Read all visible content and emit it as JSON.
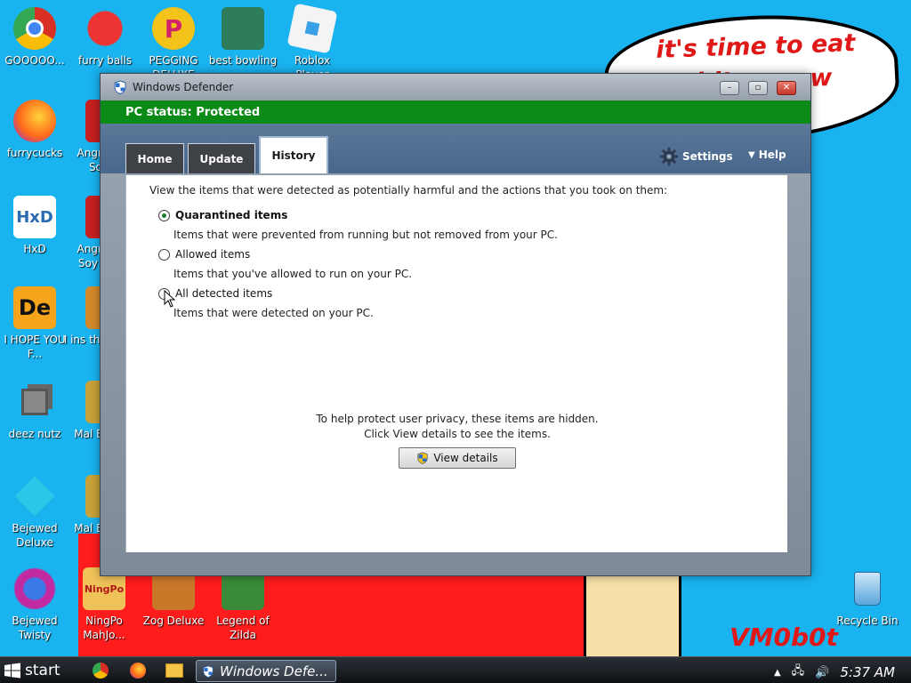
{
  "desktop": {
    "bubble_text": "it's time to eat shit ... new",
    "signature": "VM0b0t",
    "icons": [
      {
        "label": "GOOOOO...",
        "icon": "chrome-icon",
        "color": "#2a8a3a"
      },
      {
        "label": "furry balls",
        "icon": "red-creature-icon",
        "color": "#d12a2a"
      },
      {
        "label": "PEGGING DELUXE",
        "icon": "peggle-icon",
        "color": "#e34b9a"
      },
      {
        "label": "best bowling ...",
        "icon": "santa-icon",
        "color": "#3a8a5a"
      },
      {
        "label": "Roblox Player",
        "icon": "roblox-icon",
        "color": "#f2f2f2"
      },
      {
        "label": "furrycucks",
        "icon": "firefox-icon",
        "color": "#ff7a1a"
      },
      {
        "label": "Angry Soy",
        "icon": "angry-bird-icon",
        "color": "#c72020"
      },
      {
        "label": "HxD",
        "icon": "hxd-icon",
        "color": "#e9e9e9"
      },
      {
        "label": "Angry Soy V",
        "icon": "angry-bird-icon",
        "color": "#c72020"
      },
      {
        "label": "I HOPE YOU F...",
        "icon": "de-icon",
        "color": "#f2a11a"
      },
      {
        "label": "I ins this",
        "icon": "character-icon",
        "color": "#d48a2a"
      },
      {
        "label": "deez nutz",
        "icon": "window-stack-icon",
        "color": "#444444"
      },
      {
        "label": "Mal Es",
        "icon": "mahjong-icon",
        "color": "#c9a23a"
      },
      {
        "label": "Bejewed Deluxe",
        "icon": "gem-icon",
        "color": "#2cc7e8"
      },
      {
        "label": "Mal Es",
        "icon": "mahjong-icon",
        "color": "#c9a23a"
      },
      {
        "label": "Bejewed Twisty",
        "icon": "gem-icon",
        "color": "#c12aa0"
      },
      {
        "label": "NingPo MahJo...",
        "icon": "ningpo-icon",
        "color": "#d8a63a"
      },
      {
        "label": "Zog Deluxe",
        "icon": "zog-icon",
        "color": "#c9782a"
      },
      {
        "label": "Legend of Zilda",
        "icon": "link-icon",
        "color": "#3a8a3a"
      },
      {
        "label": "Recycle Bin",
        "icon": "recycle-bin-icon",
        "color": "#6ab0e0"
      }
    ]
  },
  "window": {
    "title": "Windows Defender",
    "status": "PC status: Protected",
    "tabs": [
      {
        "label": "Home"
      },
      {
        "label": "Update"
      },
      {
        "label": "History"
      }
    ],
    "settings_label": "Settings",
    "help_label": "Help",
    "intro": "View the items that were detected as potentially harmful and the actions that you took on them:",
    "options": [
      {
        "label": "Quarantined items",
        "desc": "Items that were prevented from running but not removed from your PC.",
        "selected": true
      },
      {
        "label": "Allowed items",
        "desc": "Items that you've allowed to run on your PC.",
        "selected": false
      },
      {
        "label": "All detected items",
        "desc": "Items that were detected on your PC.",
        "selected": false
      }
    ],
    "privacy_line1": "To help protect user privacy, these items are hidden.",
    "privacy_line2": "Click View details to see the items.",
    "view_details_label": "View details"
  },
  "taskbar": {
    "start_label": "start",
    "active_task": "Windows Defe...",
    "clock": "5:37 AM"
  }
}
